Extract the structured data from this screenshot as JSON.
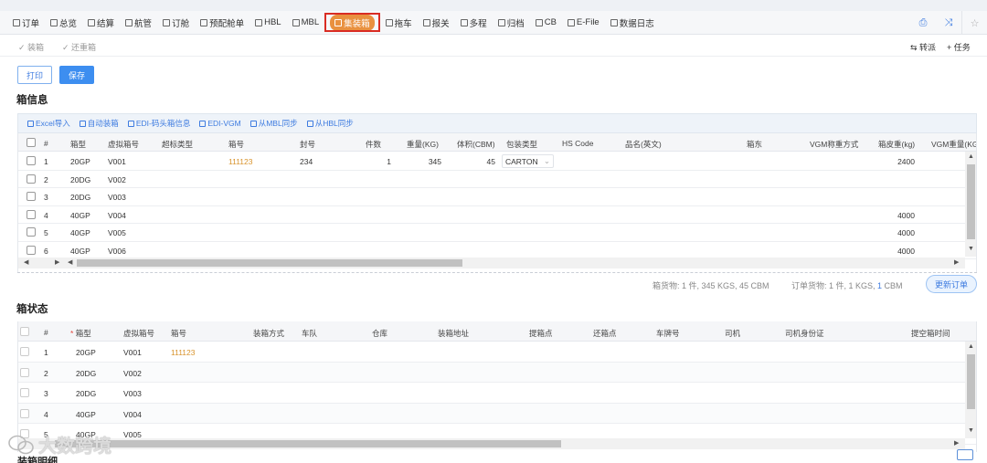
{
  "nav": {
    "items": [
      {
        "label": "订单",
        "icon": "order-icon"
      },
      {
        "label": "总览",
        "icon": "overview-icon"
      },
      {
        "label": "结算",
        "icon": "settle-icon"
      },
      {
        "label": "航管",
        "icon": "voyage-icon"
      },
      {
        "label": "订舱",
        "icon": "booking-icon"
      },
      {
        "label": "预配舱单",
        "icon": "manifest-icon"
      },
      {
        "label": "HBL",
        "icon": "hbl-icon"
      },
      {
        "label": "MBL",
        "icon": "mbl-icon"
      },
      {
        "label": "集装箱",
        "icon": "container-icon",
        "active": true
      },
      {
        "label": "拖车",
        "icon": "truck-icon"
      },
      {
        "label": "报关",
        "icon": "customs-icon"
      },
      {
        "label": "多程",
        "icon": "multileg-icon"
      },
      {
        "label": "归档",
        "icon": "archive-icon"
      },
      {
        "label": "CB",
        "icon": "cb-icon"
      },
      {
        "label": "E-File",
        "icon": "efile-icon"
      },
      {
        "label": "数据日志",
        "icon": "log-icon"
      }
    ],
    "right_icons": [
      "print-icon",
      "shuffle-icon",
      "star-icon"
    ]
  },
  "subbar": {
    "left": [
      "✓ 装箱",
      "✓ 还重箱"
    ],
    "transfer": "转派",
    "task": "任务"
  },
  "actions": {
    "print": "打印",
    "save": "保存"
  },
  "box_info": {
    "title": "箱信息",
    "toolbar": [
      "Excel导入",
      "自动装箱",
      "EDI-码头箱信息",
      "EDI-VGM",
      "从MBL同步",
      "从HBL同步"
    ],
    "columns": [
      "#",
      "箱型",
      "虚拟箱号",
      "超标类型",
      "箱号",
      "封号",
      "件数",
      "重量(KG)",
      "体积(CBM)",
      "包装类型",
      "HS Code",
      "品名(英文)",
      "箱东",
      "VGM称重方式",
      "箱皮重(kg)",
      "VGM重量(KG"
    ],
    "rows": [
      {
        "no": "1",
        "type": "20GP",
        "vno": "V001",
        "box_no": "111123",
        "seal": "234",
        "pcs": "1",
        "weight": "345",
        "cbm": "45",
        "pack": "CARTON",
        "tare": "2400"
      },
      {
        "no": "2",
        "type": "20DG",
        "vno": "V002",
        "box_no": "",
        "seal": "",
        "pcs": "",
        "weight": "",
        "cbm": "",
        "pack": "",
        "tare": ""
      },
      {
        "no": "3",
        "type": "20DG",
        "vno": "V003",
        "box_no": "",
        "seal": "",
        "pcs": "",
        "weight": "",
        "cbm": "",
        "pack": "",
        "tare": ""
      },
      {
        "no": "4",
        "type": "40GP",
        "vno": "V004",
        "box_no": "",
        "seal": "",
        "pcs": "",
        "weight": "",
        "cbm": "",
        "pack": "",
        "tare": "4000"
      },
      {
        "no": "5",
        "type": "40GP",
        "vno": "V005",
        "box_no": "",
        "seal": "",
        "pcs": "",
        "weight": "",
        "cbm": "",
        "pack": "",
        "tare": "4000"
      },
      {
        "no": "6",
        "type": "40GP",
        "vno": "V006",
        "box_no": "",
        "seal": "",
        "pcs": "",
        "weight": "",
        "cbm": "",
        "pack": "",
        "tare": "4000"
      }
    ],
    "summary_box": "箱货物: 1 件, 345 KGS, 45 CBM",
    "summary_order_prefix": "订单货物: 1 件, 1 KGS, ",
    "summary_order_cbm": "1",
    "summary_order_suffix": " CBM",
    "update_order": "更新订单"
  },
  "box_status": {
    "title": "箱状态",
    "columns": [
      "#",
      "箱型",
      "虚拟箱号",
      "箱号",
      "装箱方式",
      "车队",
      "仓库",
      "装箱地址",
      "提箱点",
      "还箱点",
      "车牌号",
      "司机",
      "司机身份证",
      "提空箱时间"
    ],
    "required_mark": "*",
    "rows": [
      {
        "no": "1",
        "type": "20GP",
        "vno": "V001",
        "box_no": "111123"
      },
      {
        "no": "2",
        "type": "20DG",
        "vno": "V002",
        "box_no": ""
      },
      {
        "no": "3",
        "type": "20DG",
        "vno": "V003",
        "box_no": ""
      },
      {
        "no": "4",
        "type": "40GP",
        "vno": "V004",
        "box_no": ""
      },
      {
        "no": "5",
        "type": "40GP",
        "vno": "V005",
        "box_no": ""
      }
    ]
  },
  "watermark": "大数跨境",
  "bottom_section_hint": "装箱明细"
}
